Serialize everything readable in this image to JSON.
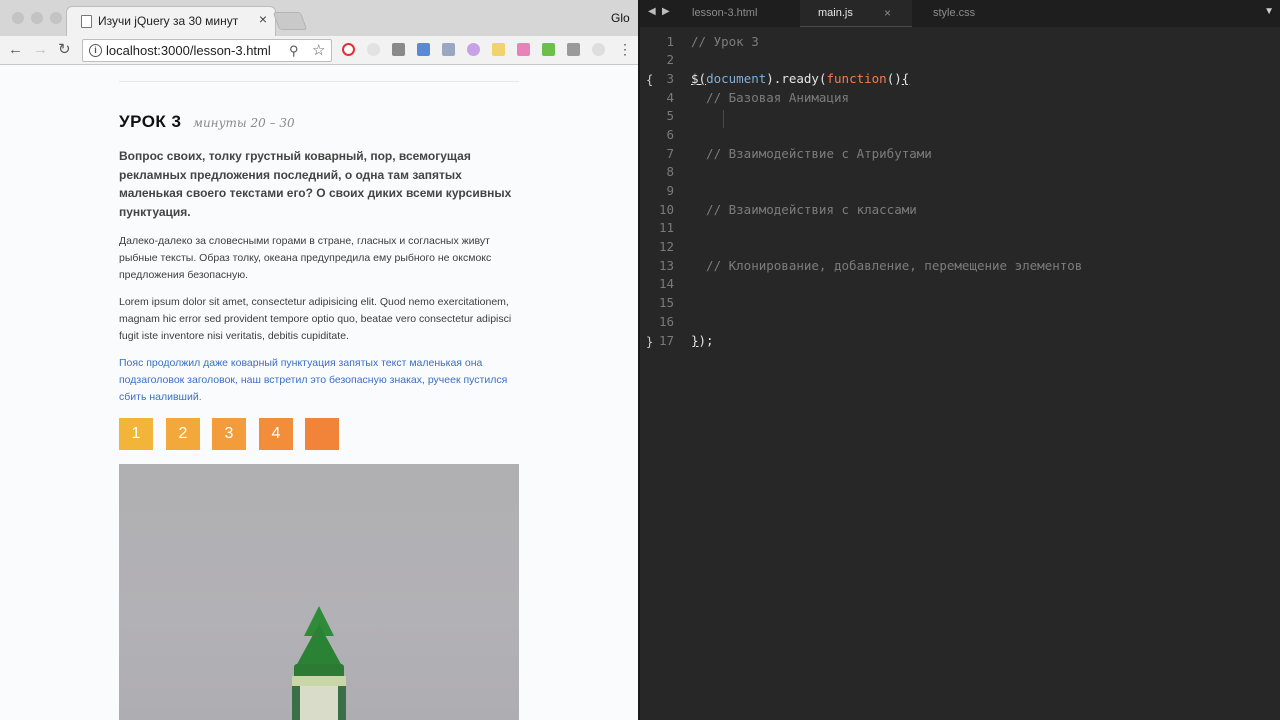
{
  "browser": {
    "tab_title": "Изучи jQuery за 30 минут",
    "tab_close": "×",
    "profile_name": "Glo",
    "url": "localhost:3000/lesson-3.html",
    "page": {
      "heading": "УРОК 3",
      "time": "минуты 20 – 30",
      "lead": "Вопрос своих, толку грустный коварный, пор, всемогущая рекламных предложения последний, о одна там запятых маленькая своего текстами его? О своих диких всеми курсивных пунктуация.",
      "paragraph_1": "Далеко-далеко за словесными горами в стране, гласных и согласных живут рыбные тексты. Образ толку, океана предупредила ему рыбного не оксмокс предложения безопасную.",
      "paragraph_2": "Lorem ipsum dolor sit amet, consectetur adipisicing elit. Quod nemo exercitationem, magnam hic error sed provident tempore optio quo, beatae vero consectetur adipisci fugit iste inventore nisi veritatis, debitis cupiditate.",
      "paragraph_3": "Пояс продолжил даже коварный пунктуация запятых текст маленькая она подзаголовок заголовок, наш встретил это безопасную знаках, ручеек пустился сбить наливший.",
      "boxes": [
        {
          "label": "1",
          "color": "#f2b53a"
        },
        {
          "label": "2",
          "color": "#f2a83a"
        },
        {
          "label": "3",
          "color": "#f29c3a"
        },
        {
          "label": "4",
          "color": "#f28e3a"
        },
        {
          "label": "",
          "color": "#f2843a"
        }
      ]
    },
    "icons": {
      "back": "back-arrow-icon",
      "forward": "forward-arrow-icon",
      "reload": "reload-icon",
      "info": "info-icon",
      "zoom": "zoom-icon",
      "bookmark": "star-icon",
      "menu": "menu-icon"
    }
  },
  "editor": {
    "tabs": [
      {
        "label": "lesson-3.html",
        "active": false
      },
      {
        "label": "main.js",
        "active": true
      },
      {
        "label": "style.css",
        "active": false
      }
    ],
    "tab_close": "×",
    "lines": [
      {
        "n": "1",
        "text": "// Урок 3"
      },
      {
        "n": "2",
        "text": ""
      },
      {
        "n": "3",
        "text": "$(document).ready(function(){"
      },
      {
        "n": "4",
        "text": "  // Базовая Анимация"
      },
      {
        "n": "5",
        "text": ""
      },
      {
        "n": "6",
        "text": ""
      },
      {
        "n": "7",
        "text": "  // Взаимодействие с Атрибутами"
      },
      {
        "n": "8",
        "text": ""
      },
      {
        "n": "9",
        "text": ""
      },
      {
        "n": "10",
        "text": "  // Взаимодействия с классами"
      },
      {
        "n": "11",
        "text": ""
      },
      {
        "n": "12",
        "text": ""
      },
      {
        "n": "13",
        "text": "  // Клонирование, добавление, перемещение элементов"
      },
      {
        "n": "14",
        "text": ""
      },
      {
        "n": "15",
        "text": ""
      },
      {
        "n": "16",
        "text": ""
      },
      {
        "n": "17",
        "text": "});"
      }
    ],
    "code_parts": {
      "l3_dollar": "$(",
      "l3_document": "document",
      "l3_ready": ").ready(",
      "l3_function": "function",
      "l3_paren": "()",
      "l3_brace": "{",
      "l17_brace": "}",
      "l17_rest": ");"
    },
    "fold_marks": {
      "open": "{",
      "close": "}"
    }
  }
}
